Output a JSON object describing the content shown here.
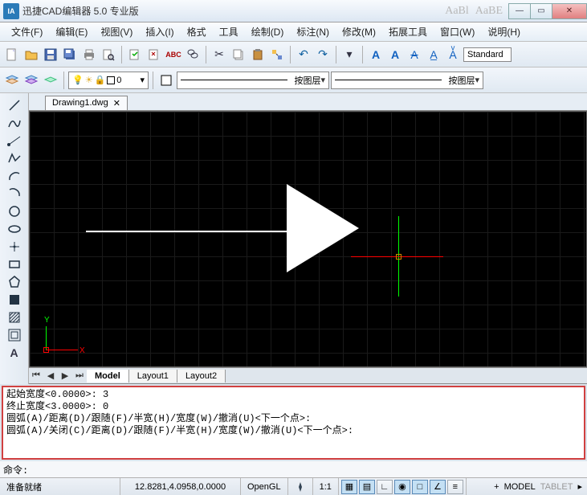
{
  "title": {
    "logo": "IA",
    "text": "迅捷CAD编辑器 5.0 专业版",
    "faded1": "AaBl",
    "faded2": "AaBE"
  },
  "menu": {
    "file": "文件(F)",
    "edit": "编辑(E)",
    "view": "视图(V)",
    "insert": "插入(I)",
    "format": "格式",
    "tools": "工具",
    "draw": "绘制(D)",
    "dimension": "标注(N)",
    "modify": "修改(M)",
    "extend": "拓展工具",
    "window": "窗口(W)",
    "help": "说明(H)"
  },
  "toolbar": {
    "standard_style": "Standard"
  },
  "propbar": {
    "layer": "0",
    "linetype": "按图层",
    "lineweight": "按图层"
  },
  "doctab": {
    "name": "Drawing1.dwg"
  },
  "modeltabs": {
    "model": "Model",
    "l1": "Layout1",
    "l2": "Layout2"
  },
  "cmd": {
    "l1": "起始宽度<0.0000>: 3",
    "l2": "终止宽度<3.0000>: 0",
    "l3": "圆弧(A)/距离(D)/跟随(F)/半宽(H)/宽度(W)/撤消(U)<下一个点>:",
    "l4": "圆弧(A)/关闭(C)/距离(D)/跟随(F)/半宽(H)/宽度(W)/撤消(U)<下一个点>:",
    "prompt": "命令:"
  },
  "ucs": {
    "x": "X",
    "y": "Y"
  },
  "status": {
    "ready": "准备就绪",
    "coords": "12.8281,4.0958,0.0000",
    "opengl": "OpenGL",
    "scale": "1:1",
    "model": "MODEL",
    "tablet": "TABLET"
  }
}
